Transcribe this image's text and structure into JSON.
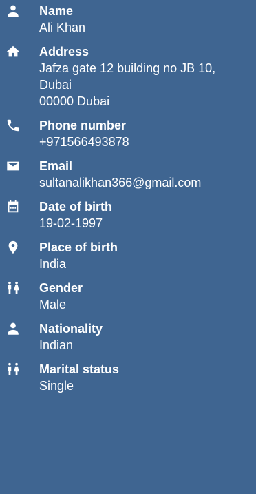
{
  "fields": [
    {
      "icon": "person-icon",
      "label": "Name",
      "lines": [
        "Ali Khan"
      ]
    },
    {
      "icon": "home-icon",
      "label": "Address",
      "lines": [
        "Jafza gate 12 building no JB 10,",
        "Dubai",
        "00000 Dubai"
      ]
    },
    {
      "icon": "phone-icon",
      "label": "Phone number",
      "lines": [
        "+971566493878"
      ]
    },
    {
      "icon": "mail-icon",
      "label": "Email",
      "lines": [
        "sultanalikhan366@gmail.com"
      ]
    },
    {
      "icon": "calendar-icon",
      "label": "Date of birth",
      "lines": [
        "19-02-1997"
      ]
    },
    {
      "icon": "location-pin-icon",
      "label": "Place of birth",
      "lines": [
        "India"
      ]
    },
    {
      "icon": "gender-icon",
      "label": "Gender",
      "lines": [
        "Male"
      ]
    },
    {
      "icon": "person-icon",
      "label": "Nationality",
      "lines": [
        "Indian"
      ]
    },
    {
      "icon": "gender-icon",
      "label": "Marital status",
      "lines": [
        "Single"
      ]
    }
  ],
  "colors": {
    "background": "#3f6591",
    "text": "#ffffff"
  }
}
